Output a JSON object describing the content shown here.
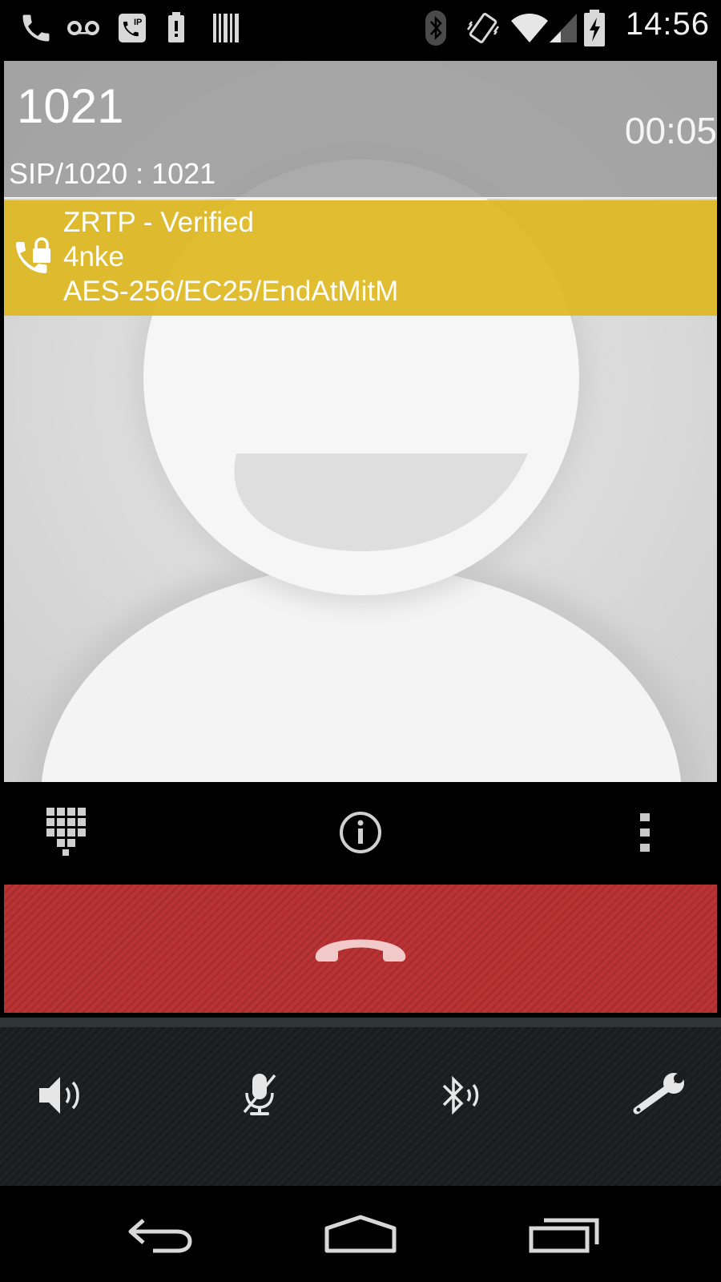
{
  "status_bar": {
    "time": "14:56",
    "icons": [
      "phone-icon",
      "voicemail-icon",
      "sip-call-icon",
      "battery-saver-icon",
      "barcode-icon",
      "bluetooth-icon",
      "vibrate-icon",
      "wifi-icon",
      "signal-icon",
      "battery-charging-icon"
    ]
  },
  "call": {
    "caller_name": "1021",
    "timer": "00:05",
    "sip_line": "SIP/1020 : 1021"
  },
  "zrtp": {
    "status": "ZRTP - Verified",
    "sas": "4nke",
    "cipher": "AES-256/EC25/EndAtMitM",
    "color": "#deb81f"
  },
  "action_bar": {
    "icons": [
      "dialpad-icon",
      "info-icon",
      "overflow-menu-icon"
    ]
  },
  "hangup": {
    "icon": "end-call-icon",
    "color": "#b93234"
  },
  "controls": {
    "icons": [
      "speaker-icon",
      "mute-mic-icon",
      "bluetooth-audio-icon",
      "settings-wrench-icon"
    ]
  },
  "nav_bar": {
    "icons": [
      "back-icon",
      "home-icon",
      "recents-icon"
    ]
  }
}
